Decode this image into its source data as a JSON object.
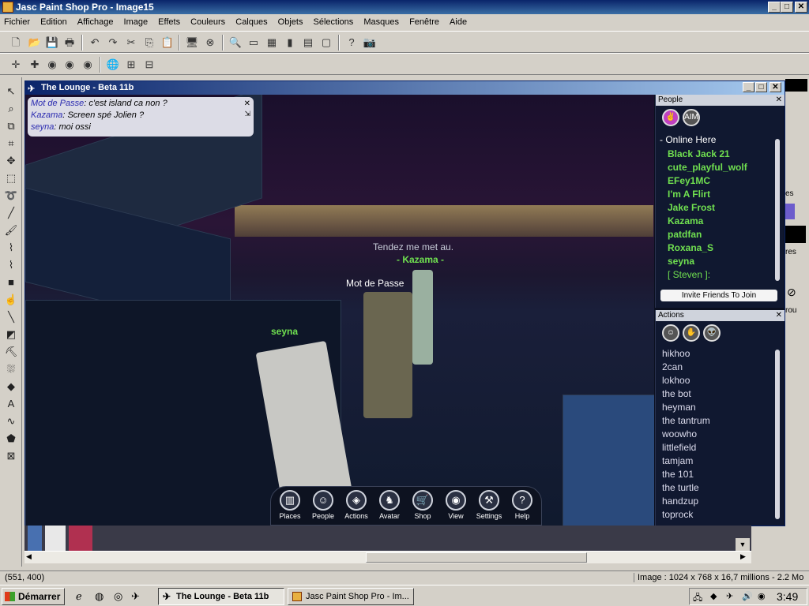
{
  "psp": {
    "title": "Jasc Paint Shop Pro - Image15",
    "menu": [
      "Fichier",
      "Edition",
      "Affichage",
      "Image",
      "Effets",
      "Couleurs",
      "Calques",
      "Objets",
      "Sélections",
      "Masques",
      "Fenêtre",
      "Aide"
    ],
    "status_left": "(551, 400)",
    "status_right": "Image :  1024 x 768 x 16,7 millions - 2.2 Mo",
    "side_text_1": "es",
    "side_text_2": "res",
    "side_text_3": "rou"
  },
  "lounge": {
    "title": "The Lounge - Beta 11b",
    "chat": [
      {
        "name": "Mot de Passe",
        "text": ": c'est island ca non ?"
      },
      {
        "name": "Kazama",
        "text": ": Screen spé Jolien ?"
      },
      {
        "name": "seyna",
        "text": ": moi ossi"
      }
    ],
    "scene_labels": {
      "say_text": "Tendez me met au.",
      "kazama": "- Kazama -",
      "mot_de_passe": "Mot de Passe",
      "seyna": "seyna"
    },
    "dock": [
      {
        "label": "Places",
        "icon": "places-icon"
      },
      {
        "label": "People",
        "icon": "people-icon"
      },
      {
        "label": "Actions",
        "icon": "actions-icon"
      },
      {
        "label": "Avatar",
        "icon": "avatar-icon"
      },
      {
        "label": "Shop",
        "icon": "shop-icon"
      },
      {
        "label": "View",
        "icon": "view-icon"
      },
      {
        "label": "Settings",
        "icon": "settings-icon"
      },
      {
        "label": "Help",
        "icon": "help-icon"
      }
    ],
    "people": {
      "header": "People",
      "online_header": "- Online Here",
      "names": [
        "Black Jack 21",
        "cute_playful_wolf",
        "EFey1MC",
        "I'm A Flirt",
        "Jake Frost",
        "Kazama",
        "patdfan",
        "Roxana_S",
        "seyna",
        "[ Steven ]:"
      ],
      "invite": "Invite Friends To Join"
    },
    "actions": {
      "header": "Actions",
      "items": [
        "hikhoo",
        "2can",
        "lokhoo",
        "the bot",
        "heyman",
        "the tantrum",
        "woowho",
        "littlefield",
        "tamjam",
        "the 101",
        "the turtle",
        "handzup",
        "toprock"
      ]
    }
  },
  "taskbar": {
    "start": "Démarrer",
    "tasks": [
      "The Lounge - Beta 11b",
      "Jasc Paint Shop Pro - Im..."
    ],
    "clock": "3:49"
  },
  "colors": {
    "title_blue": "#0a246a",
    "name_green": "#70e050",
    "chat_name": "#2a2ab0"
  }
}
